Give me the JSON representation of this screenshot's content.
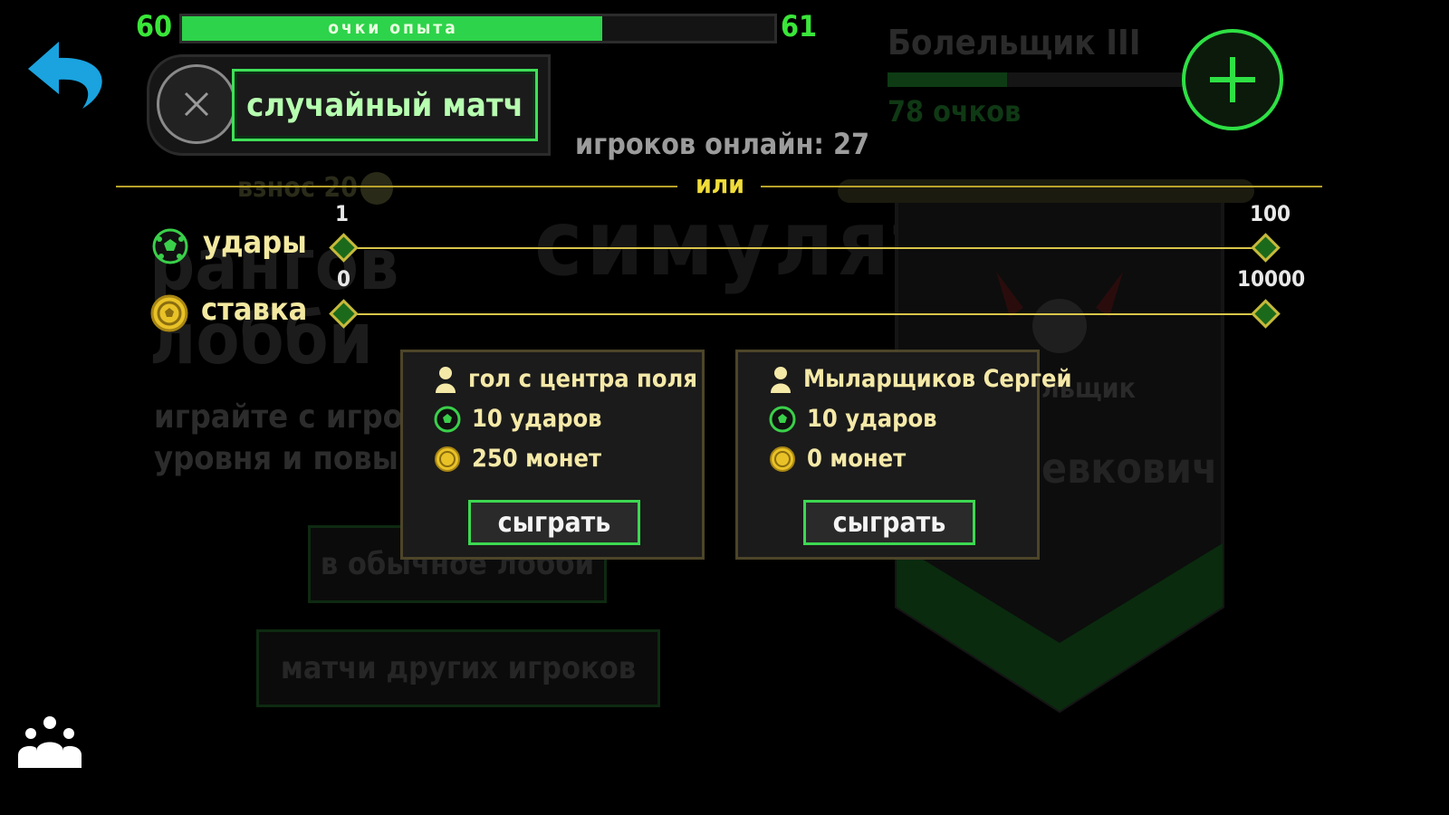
{
  "xp": {
    "current_level": "60",
    "next_level": "61",
    "label": "очки опыта",
    "progress": 0.71
  },
  "random_match": {
    "label": "случайный матч"
  },
  "players_online": "игроков онлайн: 27",
  "divider_text": "или",
  "filters": {
    "kicks": {
      "label": "удары",
      "min": "1",
      "max": "100"
    },
    "bet": {
      "label": "ставка",
      "min": "0",
      "max": "10000"
    }
  },
  "matches": [
    {
      "player": "гол с центра поля",
      "kicks": "10 ударов",
      "coins": "250 монет",
      "button": "сыграть"
    },
    {
      "player": "Мыларщиков Сергей",
      "kicks": "10 ударов",
      "coins": "0 монет",
      "button": "сыграть"
    }
  ],
  "background": {
    "fee": "взнос 20",
    "title_line1": "рангов",
    "title_line2": "лобби",
    "simulator": "симулятор вр",
    "desc_line1": "играйте с игрока",
    "desc_line2": "уровня и повыша",
    "normal_lobby": "в обычное лобби",
    "other_matches": "матчи других игроков",
    "rank_title": "Болельщик III",
    "rank_points": "78 очков",
    "rank_progress": 0.4,
    "badge_label": "льщик",
    "badge_name": "евкович"
  },
  "colors": {
    "accent_green": "#39e639",
    "gold": "#d9c64a",
    "card_border": "#4d4529"
  },
  "icons": [
    "back-arrow-icon",
    "close-icon",
    "add-icon",
    "ball-icon",
    "coin-icon",
    "player-icon",
    "friends-icon"
  ]
}
